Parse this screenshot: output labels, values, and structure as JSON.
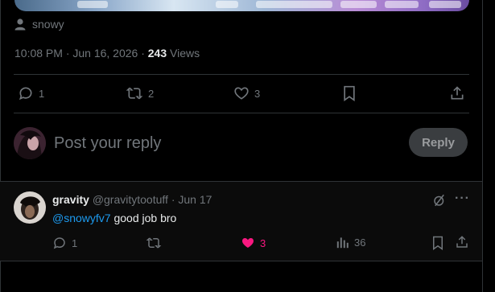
{
  "post": {
    "author": "snowy",
    "timestamp": "10:08 PM · Jun 16, 2026 · ",
    "views_count": "243",
    "views_label": " Views",
    "actions": {
      "replies": "1",
      "reposts": "2",
      "likes": "3"
    }
  },
  "composer": {
    "placeholder": "Post your reply",
    "reply_label": "Reply"
  },
  "reply": {
    "display_name": "gravity",
    "handle_date": "@gravitytootuff · Jun 17",
    "mention": "@snowyfv7",
    "text": " good job bro",
    "actions": {
      "replies": "1",
      "likes": "3",
      "views": "36"
    },
    "like_color": "#f91880",
    "mention_color": "#1d9bf0"
  }
}
